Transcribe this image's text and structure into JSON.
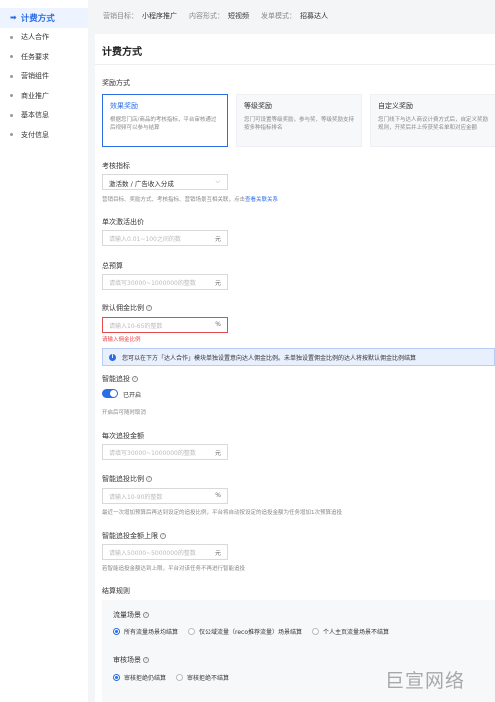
{
  "sidebar": {
    "items": [
      {
        "label": "计费方式",
        "active": true
      },
      {
        "label": "达人合作"
      },
      {
        "label": "任务要求"
      },
      {
        "label": "营销组件"
      },
      {
        "label": "商业推广"
      },
      {
        "label": "基本信息"
      },
      {
        "label": "支付信息"
      }
    ]
  },
  "topbar": {
    "goal_key": "营销目标：",
    "goal_val": "小程序推广",
    "form_key": "内容形式：",
    "form_val": "短视频",
    "mode_key": "发单模式：",
    "mode_val": "招募达人"
  },
  "page_title": "计费方式",
  "reward": {
    "label": "奖励方式",
    "cards": [
      {
        "title": "效果奖励",
        "desc": "根据您门店/商品的考核指标，平台审核通过后视频可以参与结算"
      },
      {
        "title": "等级奖励",
        "desc": "您门可设置等级奖励，参与奖、等级奖励支持按多种指标排名"
      },
      {
        "title": "自定义奖励",
        "desc": "您门线下与达人商议计费方式后，自定义奖励规则，开奖后并上传获奖名单和对应金额"
      }
    ]
  },
  "metric": {
    "label": "考核指标",
    "value": "激活数 / 广告收入分成",
    "hint": "营销目标、奖励方式、考核指标、营销场景互相关联，点击",
    "hint_link": "查看关联关系"
  },
  "unit_price": {
    "label": "单次激活出价",
    "placeholder": "请输入0.01~100之间的数",
    "unit": "元"
  },
  "budget": {
    "label": "总预算",
    "placeholder": "请填写30000~1000000的整数",
    "unit": "元"
  },
  "commission": {
    "label": "默认佣金比例",
    "placeholder": "请输入10-65的整数",
    "unit": "%",
    "error": "请输入佣金比例"
  },
  "info": {
    "text": "您可以在下方「达人合作」模块单独设置意向达人佣金比例。未单独设置佣金比例的达人将按默认佣金比例结算"
  },
  "smart_boost": {
    "label": "智能追投",
    "toggle_label": "已开启",
    "hint": "开启后可随时取消"
  },
  "per_boost": {
    "label": "每次追投金额",
    "placeholder": "请填写30000~1000000的整数",
    "unit": "元"
  },
  "boost_ratio": {
    "label": "智能追投比例",
    "placeholder": "请输入10-90的整数",
    "unit": "%",
    "hint": "最近一次增加预算后再达到设定的追投比例，平台将自动按设定的追投金额为任务增加1次预算追投"
  },
  "boost_cap": {
    "label": "智能追投金额上限",
    "placeholder": "请输入50000~5000000的整数",
    "unit": "元",
    "hint": "若智能追投金额达到上限，平台对该任务不再进行智能追投"
  },
  "settle": {
    "label": "结算规则",
    "traffic": {
      "label": "流量场景",
      "options": [
        "所有流量场景均结算",
        "仅公域流量（reco推荐流量）场景结算",
        "个人主页流量场景不结算"
      ]
    },
    "review": {
      "label": "审核场景",
      "options": [
        "审核拒绝仍结算",
        "审核拒绝不结算"
      ]
    }
  },
  "watermark": "巨宣网络",
  "colors": {
    "accent": "#2b6de5",
    "error": "#e5484d"
  }
}
